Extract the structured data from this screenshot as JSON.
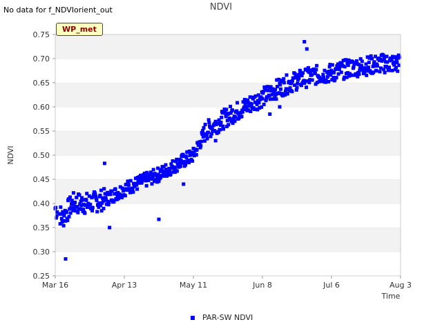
{
  "header": {
    "status_message": "No data for f_NDVIorient_out",
    "title": "NDVI"
  },
  "badge": {
    "label": "WP_met"
  },
  "chart_data": {
    "type": "scatter",
    "title": "NDVI",
    "xlabel": "Time",
    "ylabel": "NDVI",
    "x_tick_labels": [
      "Mar 16",
      "Apr 13",
      "May 11",
      "Jun 8",
      "Jul 6",
      "Aug 3"
    ],
    "x_range_days": [
      0,
      140
    ],
    "y_ticks": [
      "0.25",
      "0.30",
      "0.35",
      "0.40",
      "0.45",
      "0.50",
      "0.55",
      "0.60",
      "0.65",
      "0.70",
      "0.75"
    ],
    "ylim": [
      0.25,
      0.75
    ],
    "grid": "alternating horizontal bands",
    "legend_position": "bottom",
    "marker_color": "#0000ff",
    "series": [
      {
        "name": "PAR-SW NDVI",
        "trend": [
          [
            0,
            0.39
          ],
          [
            3,
            0.37
          ],
          [
            7,
            0.4
          ],
          [
            14,
            0.4
          ],
          [
            21,
            0.41
          ],
          [
            28,
            0.43
          ],
          [
            35,
            0.445
          ],
          [
            42,
            0.46
          ],
          [
            49,
            0.48
          ],
          [
            56,
            0.5
          ],
          [
            61,
            0.55
          ],
          [
            70,
            0.58
          ],
          [
            77,
            0.6
          ],
          [
            84,
            0.62
          ],
          [
            91,
            0.64
          ],
          [
            98,
            0.655
          ],
          [
            105,
            0.665
          ],
          [
            112,
            0.67
          ],
          [
            119,
            0.68
          ],
          [
            126,
            0.685
          ],
          [
            133,
            0.69
          ],
          [
            140,
            0.69
          ]
        ],
        "outliers": [
          [
            4.2,
            0.285
          ],
          [
            20,
            0.483
          ],
          [
            42,
            0.367
          ],
          [
            52,
            0.44
          ],
          [
            87,
            0.585
          ],
          [
            91,
            0.6
          ],
          [
            102,
            0.72
          ],
          [
            101,
            0.735
          ],
          [
            65,
            0.53
          ],
          [
            22,
            0.35
          ]
        ]
      }
    ]
  }
}
